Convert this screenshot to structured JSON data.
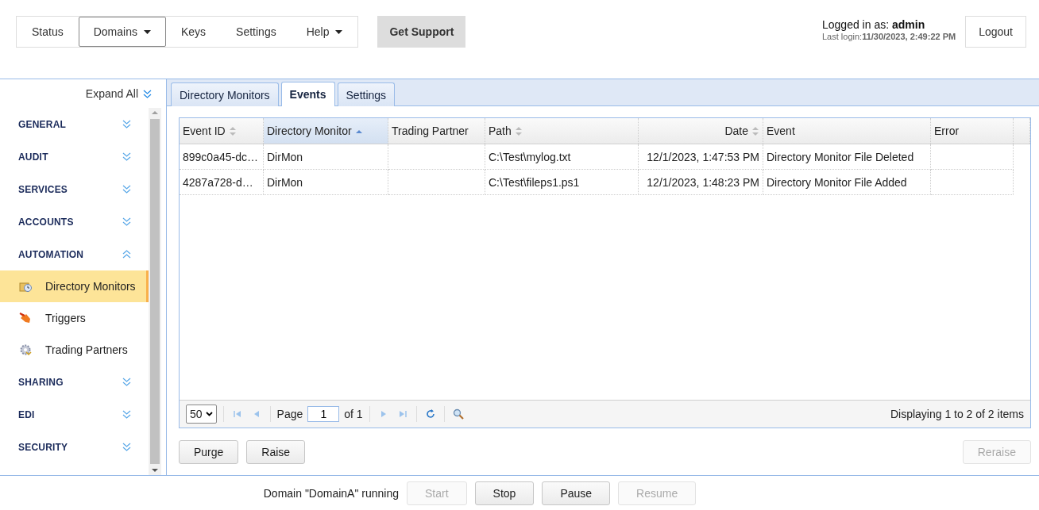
{
  "nav": {
    "items": [
      {
        "label": "Status",
        "selected": false,
        "has_menu": false
      },
      {
        "label": "Domains",
        "selected": true,
        "has_menu": true
      },
      {
        "label": "Keys",
        "selected": false,
        "has_menu": false
      },
      {
        "label": "Settings",
        "selected": false,
        "has_menu": false
      },
      {
        "label": "Help",
        "selected": false,
        "has_menu": true
      }
    ],
    "support_button": "Get Support"
  },
  "user": {
    "logged_in_label": "Logged in as:",
    "username": "admin",
    "last_login_label": "Last login:",
    "last_login": "11/30/2023, 2:49:22 PM",
    "logout": "Logout"
  },
  "sidebar": {
    "expand_all": "Expand All",
    "sections": [
      {
        "label": "GENERAL",
        "expanded": false
      },
      {
        "label": "AUDIT",
        "expanded": false
      },
      {
        "label": "SERVICES",
        "expanded": false
      },
      {
        "label": "ACCOUNTS",
        "expanded": false
      },
      {
        "label": "AUTOMATION",
        "expanded": true,
        "children": [
          {
            "label": "Directory Monitors",
            "selected": true
          },
          {
            "label": "Triggers",
            "selected": false
          },
          {
            "label": "Trading Partners",
            "selected": false
          }
        ]
      },
      {
        "label": "SHARING",
        "expanded": false
      },
      {
        "label": "EDI",
        "expanded": false
      },
      {
        "label": "SECURITY",
        "expanded": false
      }
    ]
  },
  "tabs": [
    {
      "label": "Directory Monitors",
      "selected": false
    },
    {
      "label": "Events",
      "selected": true
    },
    {
      "label": "Settings",
      "selected": false
    }
  ],
  "table": {
    "columns": [
      {
        "label": "Event ID",
        "sortable": true,
        "sorted_ascending": false
      },
      {
        "label": "Directory Monitor",
        "sortable": true,
        "sorted_ascending": true
      },
      {
        "label": "Trading Partner",
        "sortable": false,
        "sorted_ascending": false
      },
      {
        "label": "Path",
        "sortable": true,
        "sorted_ascending": false
      },
      {
        "label": "Date",
        "sortable": true,
        "sorted_ascending": false
      },
      {
        "label": "Event",
        "sortable": false,
        "sorted_ascending": false
      },
      {
        "label": "Error",
        "sortable": false,
        "sorted_ascending": false
      }
    ],
    "rows": [
      {
        "cells": {
          "event_id": "899c0a45-dc…",
          "directory_monitor": "DirMon",
          "path": "C:\\Test\\mylog.txt",
          "date": "12/1/2023, 1:47:53 PM",
          "event": "Directory Monitor File Deleted"
        }
      },
      {
        "cells": {
          "event_id": "4287a728-d…",
          "directory_monitor": "DirMon",
          "path": "C:\\Test\\fileps1.ps1",
          "date": "12/1/2023, 1:48:23 PM",
          "event": "Directory Monitor File Added"
        }
      }
    ]
  },
  "pager": {
    "page_size": "50",
    "page_label": "Page",
    "page": "1",
    "page_count": "of 1",
    "summary": "Displaying 1 to 2 of 2 items"
  },
  "actions": {
    "left": [
      {
        "label": "Purge",
        "disabled": false
      },
      {
        "label": "Raise",
        "disabled": false
      }
    ],
    "right": [
      {
        "label": "Reraise",
        "disabled": true
      }
    ]
  },
  "footer": {
    "status": "Domain \"DomainA\" running",
    "buttons": [
      {
        "label": "Start",
        "disabled": true
      },
      {
        "label": "Stop",
        "disabled": false
      },
      {
        "label": "Pause",
        "disabled": false
      },
      {
        "label": "Resume",
        "disabled": true
      }
    ]
  }
}
